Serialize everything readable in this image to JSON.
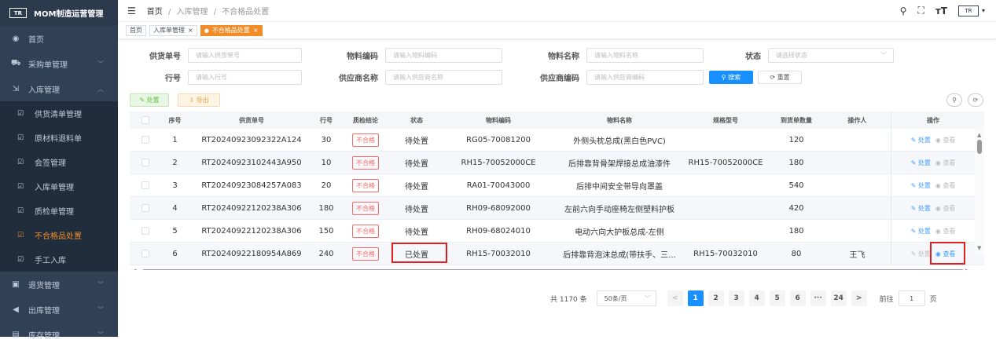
{
  "app": {
    "logo": "TR",
    "title": "MOM制造运营管理"
  },
  "sidebar": {
    "items": [
      {
        "icon": "dashboard-icon",
        "glyph": "◉",
        "label": "首页"
      },
      {
        "icon": "cart-icon",
        "glyph": "⛟",
        "label": "采购单管理",
        "chev": "﹀"
      },
      {
        "icon": "inbound-icon",
        "glyph": "⇲",
        "label": "入库管理",
        "chev": "︿"
      }
    ],
    "sub": [
      {
        "label": "供货清单管理"
      },
      {
        "label": "原材料退料单"
      },
      {
        "label": "会签管理"
      },
      {
        "label": "入库单管理"
      },
      {
        "label": "质检单管理"
      },
      {
        "label": "不合格品处置",
        "active": true
      },
      {
        "label": "手工入库"
      }
    ],
    "bottom": [
      {
        "icon": "return-icon",
        "glyph": "▣",
        "label": "退货管理",
        "chev": "﹀"
      },
      {
        "icon": "outbound-icon",
        "glyph": "◀",
        "label": "出库管理",
        "chev": "﹀"
      },
      {
        "icon": "storage-icon",
        "glyph": "▤",
        "label": "库存管理",
        "chev": "﹀"
      }
    ]
  },
  "header": {
    "menu_icon": "☰",
    "breadcrumb": [
      "首页",
      "入库管理",
      "不合格品处置"
    ],
    "sep": "/",
    "search": "⚲",
    "fullscreen": "⛶",
    "fontsize": "тT",
    "avatar": "TR",
    "avatar_caret": "▾"
  },
  "tabs": [
    {
      "label": "首页"
    },
    {
      "label": "入库单管理",
      "close": "×"
    },
    {
      "label": "不合格品处置",
      "close": "×",
      "active": true,
      "dot": "●"
    }
  ],
  "filters": {
    "row1": [
      {
        "label": "供货单号",
        "placeholder": "请输入供货单号"
      },
      {
        "label": "物料编码",
        "placeholder": "请输入物料编码"
      },
      {
        "label": "物料名称",
        "placeholder": "请输入物料名称"
      },
      {
        "label": "状态",
        "placeholder": "请选择状态",
        "caret": "﹀"
      }
    ],
    "row2": [
      {
        "label": "行号",
        "placeholder": "请输入行号"
      },
      {
        "label": "供应商名称",
        "placeholder": "请输入供应商名称"
      },
      {
        "label": "供应商编码",
        "placeholder": "请输入供应商编码"
      }
    ],
    "search_btn": "⚲ 搜索",
    "reset_btn": "⟳ 重置"
  },
  "toolbar": {
    "handle": "✎ 处置",
    "export": "⇩ 导出",
    "search_toggle": "⚲",
    "refresh": "⟳"
  },
  "table": {
    "headers": [
      "序号",
      "供货单号",
      "行号",
      "质检结论",
      "状态",
      "物料编码",
      "物料名称",
      "规格型号",
      "到货单数量",
      "操作人",
      "操作"
    ],
    "rows": [
      [
        "1",
        "RT20240923092322A124",
        "30",
        "不合格",
        "待处置",
        "RG05-70081200",
        "外侧头枕总成(黑白色PVC)",
        "",
        "120",
        ""
      ],
      [
        "2",
        "RT20240923102443A950",
        "10",
        "不合格",
        "待处置",
        "RH15-70052000CE",
        "后排靠背骨架焊接总成油漆件",
        "RH15-70052000CE",
        "180",
        ""
      ],
      [
        "3",
        "RT20240923084257A083",
        "20",
        "不合格",
        "待处置",
        "RA01-70043000",
        "后排中间安全带导向罩盖",
        "",
        "540",
        ""
      ],
      [
        "4",
        "RT20240922120238A306",
        "180",
        "不合格",
        "待处置",
        "RH09-68092000",
        "左前六向手动座椅左侧塑料护板",
        "",
        "420",
        ""
      ],
      [
        "5",
        "RT20240922120238A306",
        "150",
        "不合格",
        "待处置",
        "RH09-68024010",
        "电动六向大护板总成-左侧",
        "",
        "180",
        ""
      ],
      [
        "6",
        "RT20240922180954A869",
        "240",
        "不合格",
        "已处置",
        "RH15-70032010",
        "后排靠背泡沫总成(带扶手、三...",
        "RH15-70032010",
        "80",
        "王飞"
      ]
    ],
    "op_handle": "✎ 处置",
    "op_view": "◉ 查看"
  },
  "pagination": {
    "total": "共 1170 条",
    "size": "50条/页",
    "size_caret": "﹀",
    "prev": "<",
    "pages": [
      "1",
      "2",
      "3",
      "4",
      "5",
      "6",
      "···",
      "24"
    ],
    "next": ">",
    "goto": "前往",
    "page_input": "1",
    "page_suffix": "页"
  },
  "colors": {
    "sidebar": "#304156",
    "accent": "#f28c28",
    "primary": "#1890ff",
    "danger": "#f56c6c"
  }
}
